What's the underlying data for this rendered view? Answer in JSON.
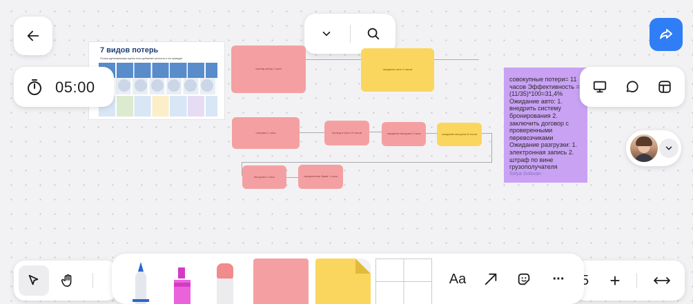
{
  "header": {
    "back_icon": "arrow-left-icon",
    "chevron_icon": "chevron-down-icon",
    "search_icon": "search-icon",
    "share_icon": "share-arrow-icon",
    "accent_color": "#2f7ef6"
  },
  "timer": {
    "value": "05:00",
    "icon": "stopwatch-icon"
  },
  "right_panel": {
    "icons": [
      "presentation-icon",
      "comment-icon",
      "layout-icon"
    ]
  },
  "collaborator": {
    "icon": "avatar"
  },
  "frame_image": {
    "title": "7 видов потерь",
    "subtitle": "Потери идентификации оценки этого добавляет ценности и что приводит"
  },
  "stickies": {
    "s1": "проезд заезд 2 часа",
    "s2": "ожидание авто 9 часов",
    "s3": "погрузка 1 часа",
    "s4": "проезд в пути 10 часов",
    "s5": "ожидание выгрузки 3 часа",
    "s6": "ожидание выгрузки 8 часов",
    "s7": "выгрузка 1 часа",
    "s8": "оформление бумаг 1 часа"
  },
  "purple_note": {
    "text": "совокупные потери= 11 часов Эффективность = (11/35)*100=31,4% Ожидание авто: 1. внедрить систему бронирования 2. заключить договор с проверенными перевозчиками Ожидание разгрузки: 1. электронная запись 2. штраф по вине грузополучателя",
    "author": "Sofya Golovan"
  },
  "toolbar": {
    "tools": [
      "cursor-icon",
      "hand-icon",
      "pen-tool",
      "highlighter-tool",
      "eraser-tool",
      "pink-sticky",
      "yellow-sticky",
      "table-tool"
    ],
    "text_label": "Aa",
    "more_label": "···",
    "zoom_plus": "+",
    "fit_label": "↔"
  },
  "colors": {
    "pink": "#f4a0a2",
    "yellow": "#fbd65e",
    "purple": "#c9a2f4"
  }
}
